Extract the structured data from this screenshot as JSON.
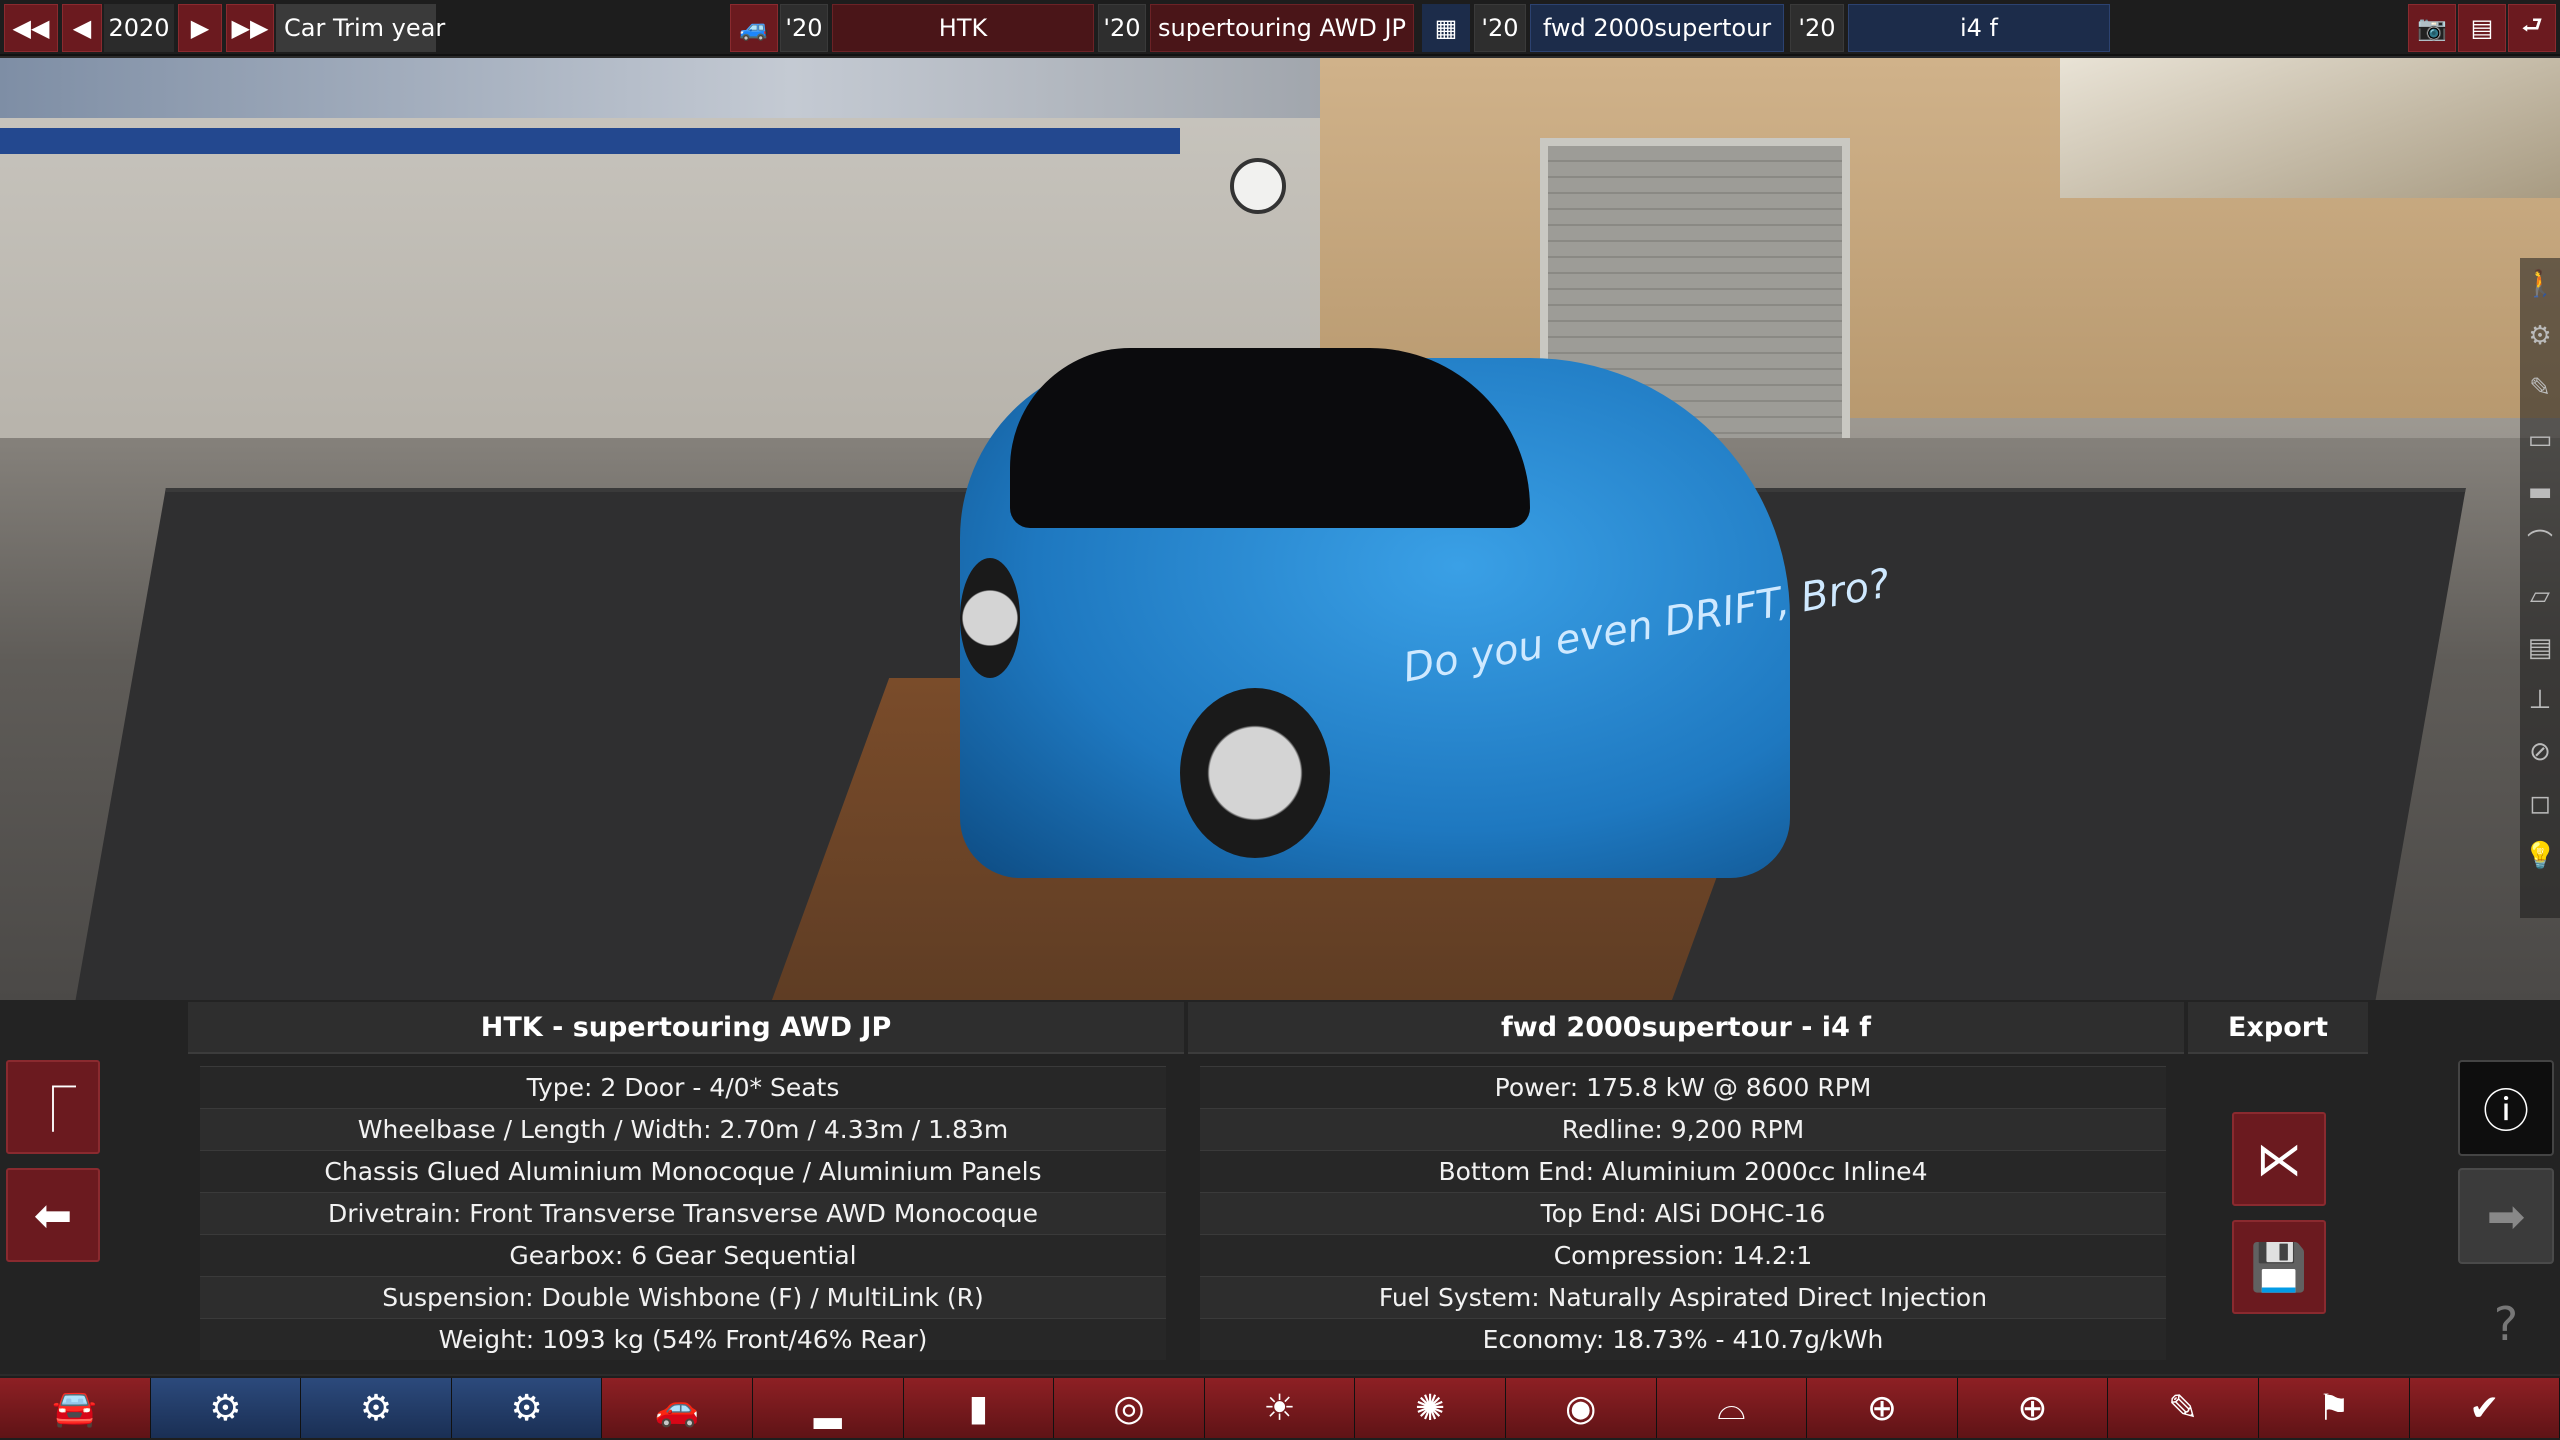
{
  "topbar": {
    "first_icon": "◀◀",
    "prev_icon": "◀",
    "year": "2020",
    "next_icon": "▶",
    "last_icon": "▶▶",
    "year_label": "Car Trim year",
    "model_year": "'20",
    "model_name": "HTK",
    "trim_year": "'20",
    "trim_name": "supertouring AWD JP",
    "engine_family_year": "'20",
    "engine_family_name": "fwd 2000supertour",
    "variant_year": "'20",
    "variant_name": "i4 f"
  },
  "panel": {
    "car_header": "HTK - supertouring AWD JP",
    "engine_header": "fwd 2000supertour - i4 f",
    "export_header": "Export",
    "car_specs": [
      "Type: 2 Door - 4/0* Seats",
      "Wheelbase / Length / Width: 2.70m / 4.33m / 1.83m",
      "Chassis Glued Aluminium Monocoque / Aluminium Panels",
      "Drivetrain: Front Transverse Transverse AWD Monocoque",
      "Gearbox: 6 Gear Sequential",
      "Suspension: Double Wishbone (F) / MultiLink (R)",
      "Weight: 1093 kg (54% Front/46% Rear)"
    ],
    "engine_specs": [
      "Power: 175.8 kW @ 8600 RPM",
      "Redline:  9,200 RPM",
      "Bottom End: Aluminium 2000cc Inline4",
      "Top End: AlSi DOHC-16",
      "Compression: 14.2:1",
      "Fuel System: Naturally Aspirated Direct Injection",
      "Economy: 18.73% - 410.7g/kWh"
    ]
  },
  "scene": {
    "livery_text": "Do you even DRIFT, Bro?"
  },
  "colors": {
    "accent_red": "#6b1a1f",
    "accent_blue": "#1c2c4a",
    "panel_bg": "#232323"
  }
}
